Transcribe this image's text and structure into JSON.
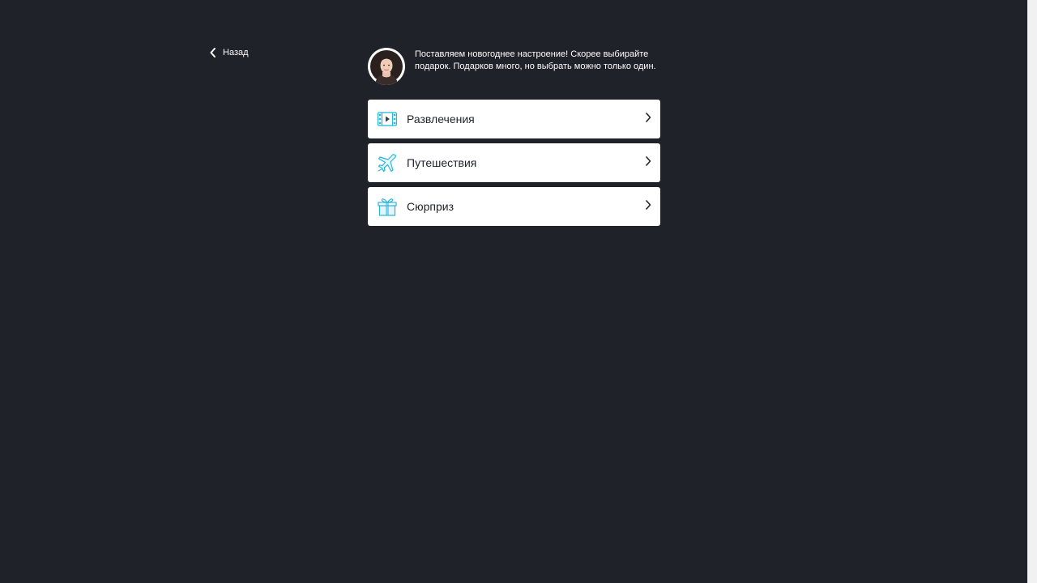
{
  "nav": {
    "back_label": "Назад"
  },
  "assistant": {
    "message": "Поставляем новогоднее настроение! Скорее выбирайте подарок. Подарков много, но выбрать можно только один."
  },
  "options": [
    {
      "label": "Развлечения",
      "icon": "film-icon"
    },
    {
      "label": "Путешествия",
      "icon": "airplane-icon"
    },
    {
      "label": "Сюрприз",
      "icon": "gift-icon"
    }
  ],
  "colors": {
    "background": "#20222a",
    "card": "#ffffff",
    "icon_accent": "#29b6d8",
    "text_dark": "#22242b"
  }
}
